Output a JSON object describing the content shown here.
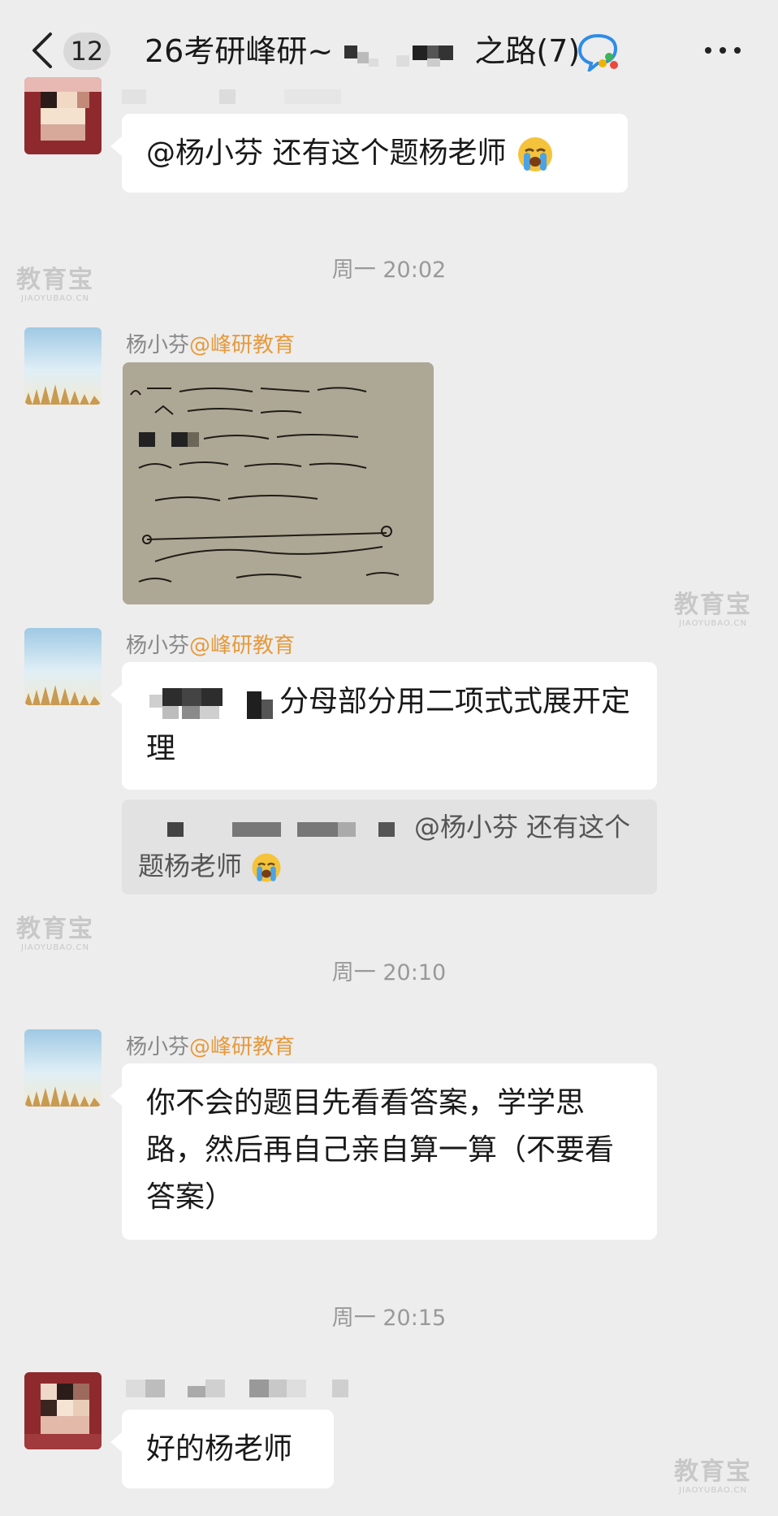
{
  "header": {
    "unread_count": "12",
    "title_prefix": "26考研峰研~",
    "title_suffix": "之路(7)"
  },
  "messages": [
    {
      "text": "@杨小芬  还有这个题杨老师"
    },
    {
      "time": "周一 20:02",
      "sender_name": "杨小芬",
      "sender_org": "@峰研教育"
    },
    {
      "sender_name": "杨小芬",
      "sender_org": "@峰研教育",
      "text": "分母部分用二项式式展开定理",
      "quote_text": "@杨小芬  还有这个题杨老师"
    },
    {
      "time": "周一 20:10",
      "sender_name": "杨小芬",
      "sender_org": "@峰研教育",
      "text": "你不会的题目先看看答案，学学思路，然后再自己亲自算一算（不要看答案）"
    },
    {
      "time": "周一 20:15",
      "text": "好的杨老师"
    }
  ],
  "watermark": {
    "brand": "教育宝",
    "domain": "JIAOYUBAO.CN"
  },
  "colors": {
    "background": "#ededed",
    "bubble": "#ffffff",
    "org_accent": "#e69a3d",
    "quote_bg": "#e2e2e2"
  }
}
